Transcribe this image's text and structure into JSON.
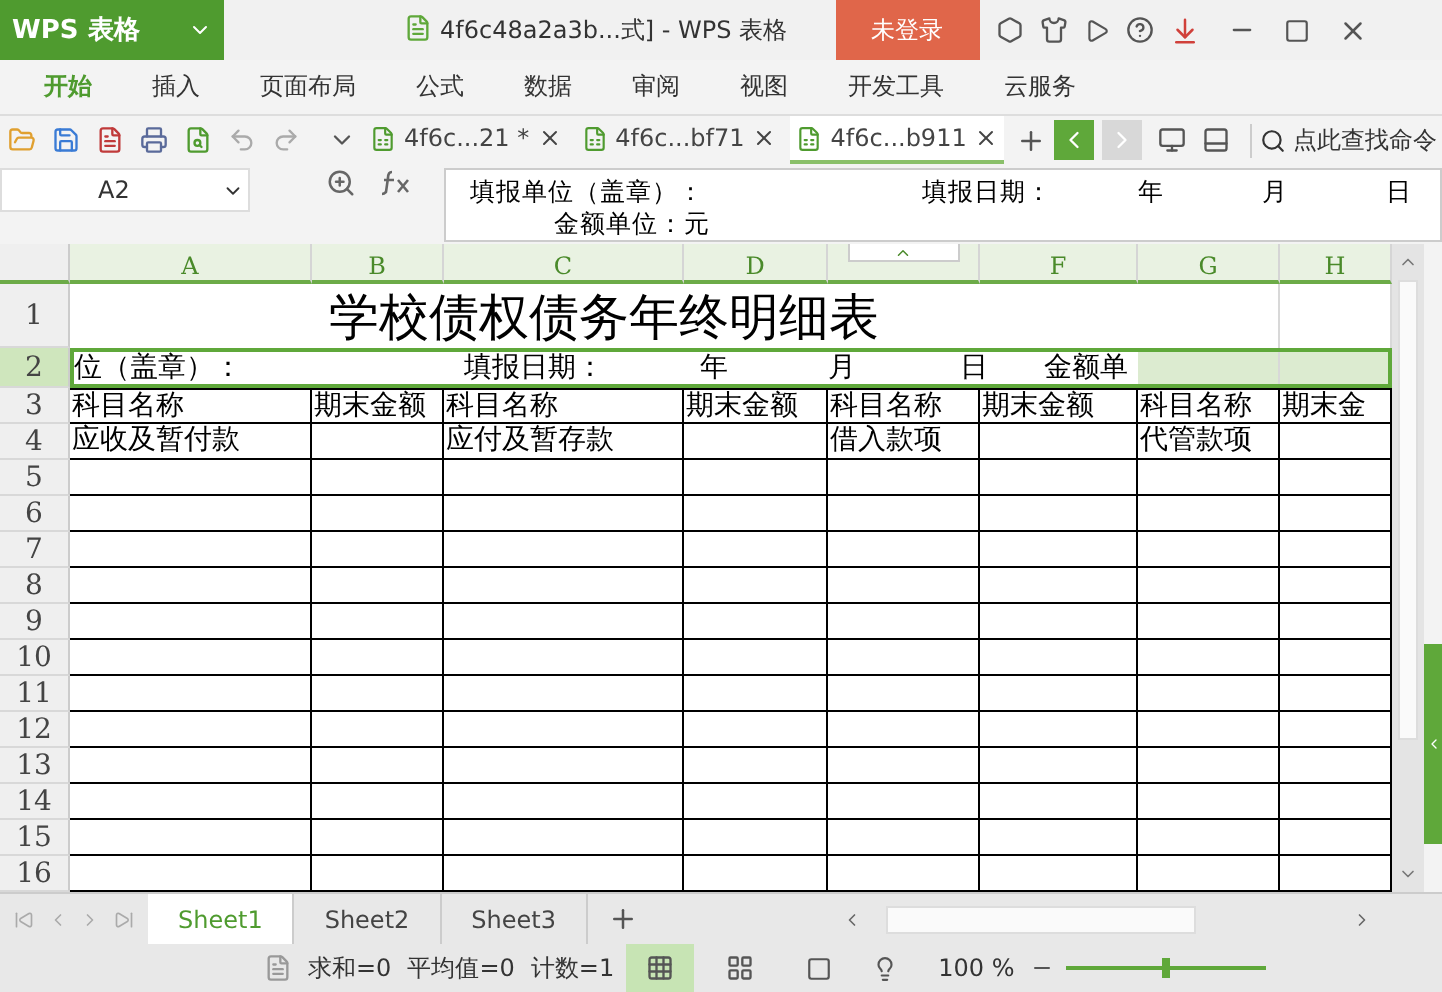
{
  "app_button": {
    "label": "WPS 表格"
  },
  "window": {
    "title": "4f6c48a2a3b...式] - WPS 表格"
  },
  "login_button": {
    "label": "未登录"
  },
  "ribbon_tabs": [
    {
      "label": "开始",
      "selected": true
    },
    {
      "label": "插入",
      "selected": false
    },
    {
      "label": "页面布局",
      "selected": false
    },
    {
      "label": "公式",
      "selected": false
    },
    {
      "label": "数据",
      "selected": false
    },
    {
      "label": "审阅",
      "selected": false
    },
    {
      "label": "视图",
      "selected": false
    },
    {
      "label": "开发工具",
      "selected": false
    },
    {
      "label": "云服务",
      "selected": false
    }
  ],
  "doc_tabs": [
    {
      "label": "4f6c...21 *",
      "selected": false
    },
    {
      "label": "4f6c...bf71",
      "selected": false
    },
    {
      "label": "4f6c...b911",
      "selected": true
    }
  ],
  "search": {
    "placeholder": "点此查找命令"
  },
  "formula_bar": {
    "cell": "A2",
    "lines": [
      [
        "填报单位（盖章）：",
        "填报日期：",
        "年",
        "月",
        "日"
      ],
      [
        "金额单位：元"
      ]
    ]
  },
  "columns": [
    {
      "label": "A"
    },
    {
      "label": "B"
    },
    {
      "label": "C"
    },
    {
      "label": "D"
    },
    {},
    {
      "label": "F"
    },
    {
      "label": "G"
    },
    {
      "label": "H"
    }
  ],
  "rows": [
    {
      "number": "1",
      "selected": false,
      "kind": "title",
      "title": "学校债权债务年终明细表"
    },
    {
      "number": "2",
      "selected": true,
      "kind": "info",
      "parts": [
        "位（盖章）：",
        "填报日期：",
        "年",
        "月",
        "日",
        "金额单"
      ]
    },
    {
      "number": "3",
      "selected": false,
      "kind": "cells",
      "cells": [
        "科目名称",
        "期末金额",
        "科目名称",
        "期末金额",
        "科目名称",
        "期末金额",
        "科目名称",
        "期末金"
      ]
    },
    {
      "number": "4",
      "selected": false,
      "kind": "cells",
      "cells": [
        "应收及暂付款",
        null,
        "应付及暂存款",
        null,
        "借入款项",
        null,
        "代管款项",
        null
      ]
    },
    {
      "number": "5",
      "selected": false,
      "kind": "cells"
    },
    {
      "number": "6",
      "selected": false,
      "kind": "cells"
    },
    {
      "number": "7",
      "selected": false,
      "kind": "cells"
    },
    {
      "number": "8",
      "selected": false,
      "kind": "cells"
    },
    {
      "number": "9",
      "selected": false,
      "kind": "cells"
    },
    {
      "number": "10",
      "selected": false,
      "kind": "cells"
    },
    {
      "number": "11",
      "selected": false,
      "kind": "cells"
    },
    {
      "number": "12",
      "selected": false,
      "kind": "cells"
    },
    {
      "number": "13",
      "selected": false,
      "kind": "cells"
    },
    {
      "number": "14",
      "selected": false,
      "kind": "cells"
    },
    {
      "number": "15",
      "selected": false,
      "kind": "cells"
    },
    {
      "number": "16",
      "selected": false,
      "kind": "cells"
    }
  ],
  "sheet_tabs": [
    {
      "label": "Sheet1",
      "selected": true
    },
    {
      "label": "Sheet2",
      "selected": false
    },
    {
      "label": "Sheet3",
      "selected": false
    }
  ],
  "status_bar": {
    "sum": "求和=0",
    "average": "平均值=0",
    "count": "计数=1",
    "zoom": "100 %"
  },
  "view_buttons": [
    {
      "selected": true
    },
    {
      "selected": false
    }
  ],
  "zoom_slider": {
    "level": 0.5
  }
}
